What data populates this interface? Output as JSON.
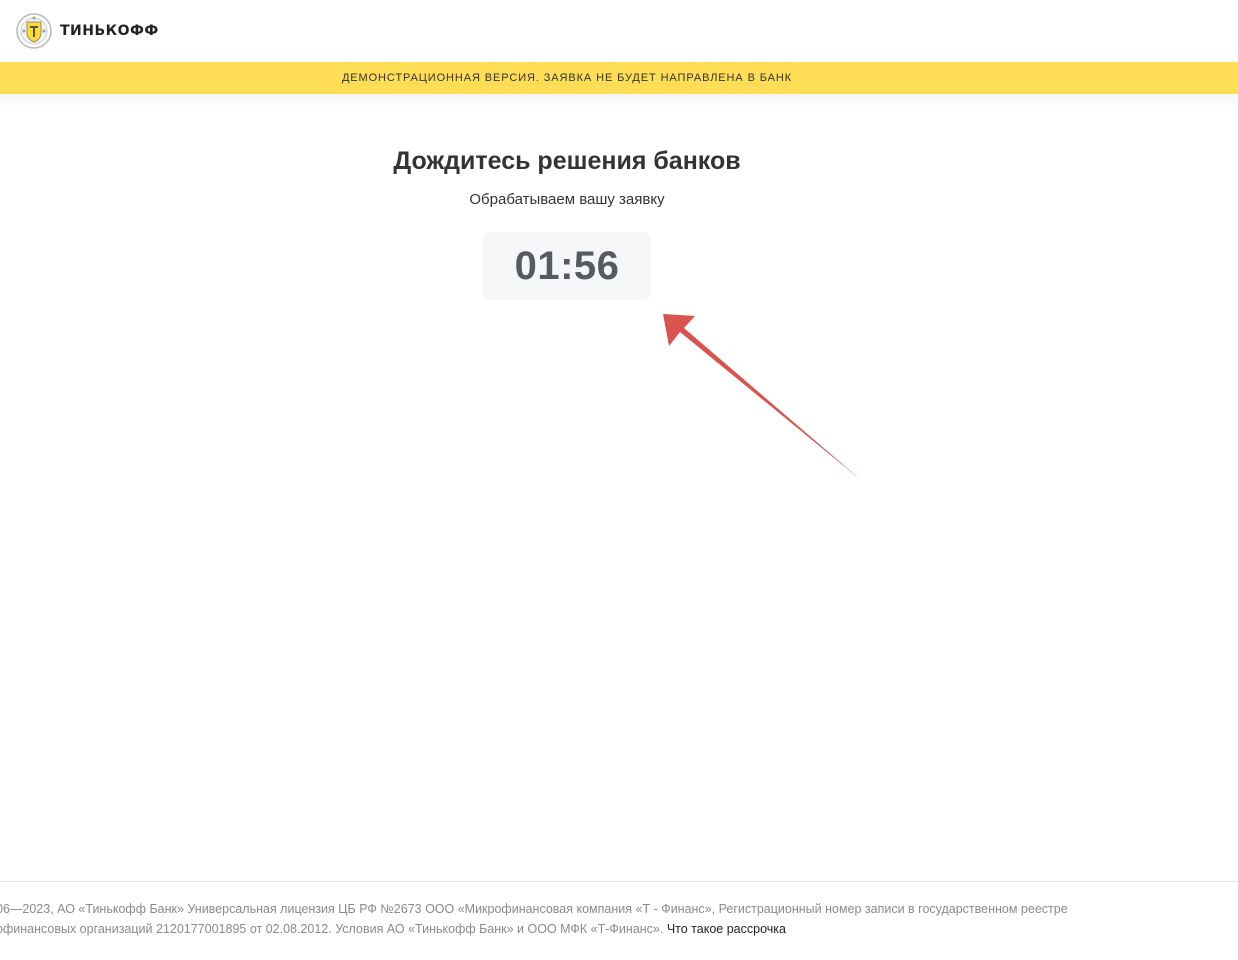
{
  "header": {
    "logo_text": "ТИНЬКОФФ"
  },
  "demo_banner": {
    "text": "ДЕМОНСТРАЦИОННАЯ ВЕРСИЯ. ЗАЯВКА НЕ БУДЕТ НАПРАВЛЕНА В БАНК"
  },
  "main": {
    "title": "Дождитесь решения банков",
    "subtitle": "Обрабатываем вашу заявку",
    "timer": "01:56"
  },
  "footer": {
    "line1": "06—2023, АО «Тинькофф Банк» Универсальная лицензия ЦБ РФ №2673 ООО «Микрофинансовая компания «Т - Финанс», Регистрационный номер записи в государственном реестре",
    "line2": "офинансовых организаций 2120177001895 от 02.08.2012.  Условия АО «Тинькофф Банк» и ООО МФК «Т-Финанс».",
    "link_text": "Что такое рассрочка"
  },
  "colors": {
    "banner": "#ffdd55",
    "arrow": "#d9534f",
    "timer_bg": "#f6f7f8"
  },
  "icons": {
    "logo": "tinkoff-emblem-icon",
    "annotation": "red-arrow-annotation"
  }
}
